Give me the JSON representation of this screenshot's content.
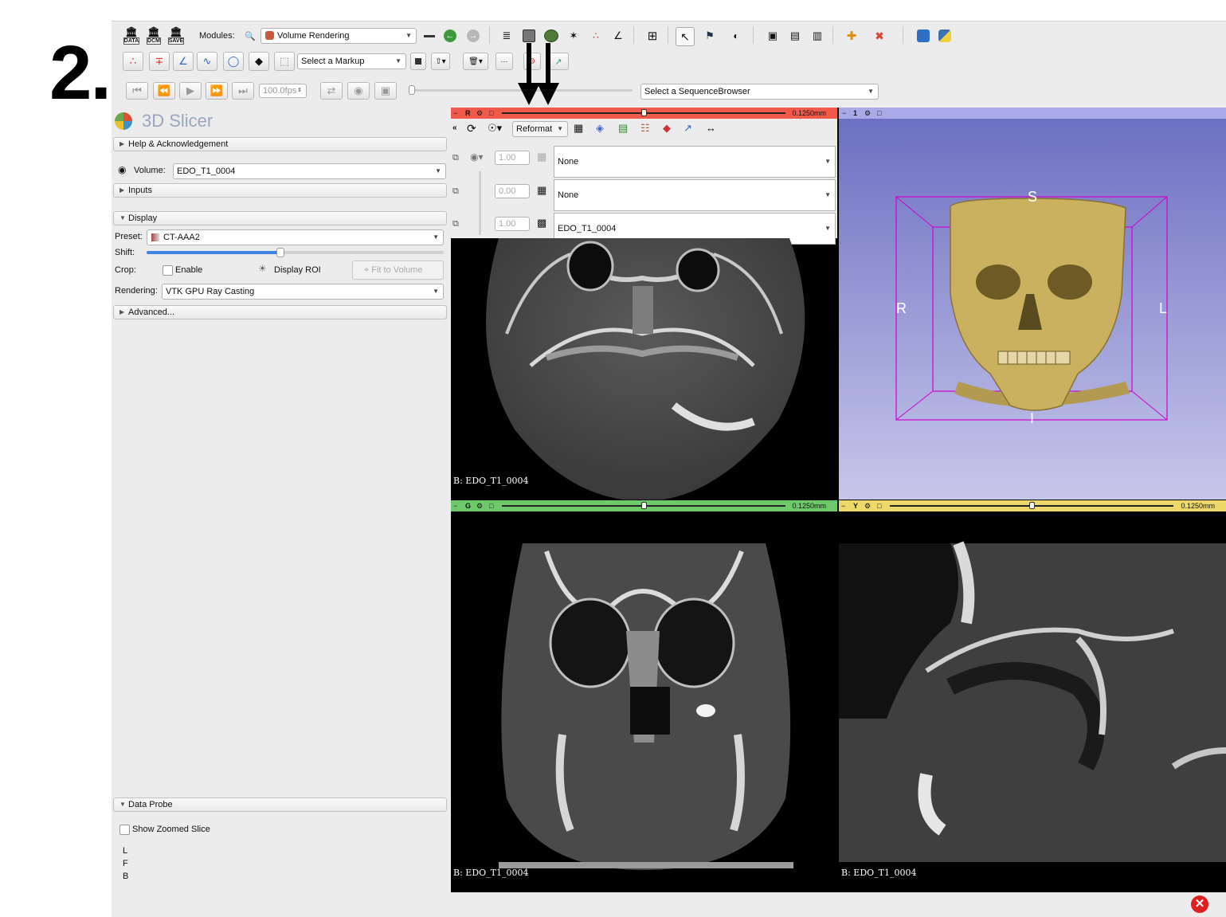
{
  "step_label": "2.",
  "toolbar1": {
    "modules_label": "Modules:",
    "module_selected": "Volume Rendering",
    "data_label": "DATA",
    "dcm_label": "DCM",
    "save_label": "SAVE"
  },
  "toolbar2": {
    "markup_placeholder": "Select a Markup"
  },
  "toolbar3": {
    "fps": "100.0fps",
    "sequence_browser": "Select a SequenceBrowser"
  },
  "panel": {
    "title": "3D Slicer",
    "help": "Help & Acknowledgement",
    "volume_label": "Volume:",
    "volume_value": "EDO_T1_0004",
    "inputs": "Inputs",
    "display": "Display",
    "preset_label": "Preset:",
    "preset_value": "CT-AAA2",
    "shift_label": "Shift:",
    "shift_fraction": 0.45,
    "crop_label": "Crop:",
    "enable_label": "Enable",
    "display_roi_label": "Display ROI",
    "fit_volume_label": "Fit to Volume",
    "rendering_label": "Rendering:",
    "rendering_value": "VTK GPU Ray Casting",
    "advanced": "Advanced...",
    "data_probe": "Data Probe",
    "show_zoomed": "Show Zoomed Slice",
    "probe_l": "L",
    "probe_f": "F",
    "probe_b": "B"
  },
  "red_view": {
    "letter": "R",
    "spacing": "0.1250mm",
    "slider_fraction": 0.5,
    "reformat_label": "Reformat",
    "fg_opacity": "1.00",
    "fg_volume": "None",
    "label_opacity": "0.00",
    "label_volume": "None",
    "bg_opacity": "1.00",
    "bg_volume": "EDO_T1_0004",
    "annotation": "B: EDO_T1_0004"
  },
  "threed_view": {
    "number": "1",
    "axis_s": "S",
    "axis_r": "R",
    "axis_l": "L",
    "axis_i": "I"
  },
  "green_view": {
    "letter": "G",
    "spacing": "0.1250mm",
    "slider_fraction": 0.5,
    "annotation": "B: EDO_T1_0004"
  },
  "yellow_view": {
    "letter": "Y",
    "spacing": "0.1250mm",
    "slider_fraction": 0.5,
    "annotation": "B: EDO_T1_0004"
  },
  "colors": {
    "red_bar": "#f15a4a",
    "green_bar": "#6ec96a",
    "yellow_bar": "#ecd96a",
    "threed_bar": "#a9a9e8",
    "threed_bg_top": "#6d6fc2",
    "threed_bg_bottom": "#c6c7ea",
    "roi_box": "#d000d0",
    "bone": "#c9b160"
  },
  "icons": {
    "close": "close-icon",
    "python": "python-icon",
    "extension": "extension-icon"
  }
}
